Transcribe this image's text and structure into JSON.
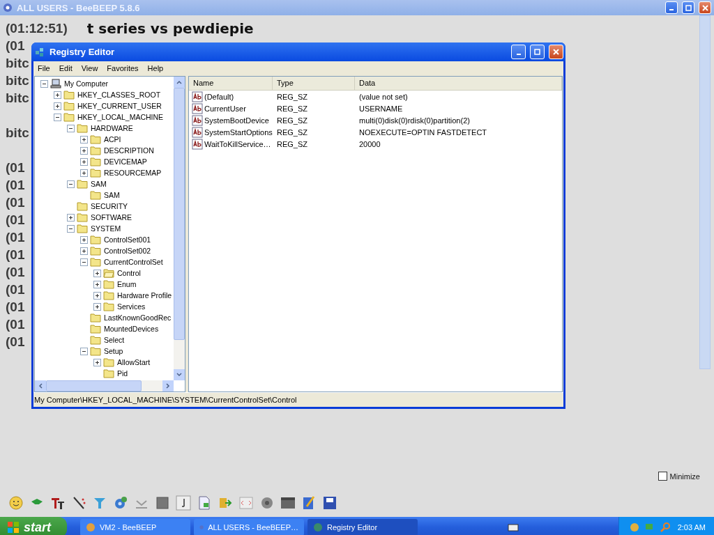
{
  "background_window": {
    "title": "ALL USERS - BeeBEEP 5.8.6",
    "chat_lines": [
      {
        "kind": "line",
        "time": "(01:12:51)",
        "message": "t series vs pewdiepie"
      },
      {
        "kind": "line",
        "time": "(01"
      },
      {
        "kind": "line",
        "time": "bitc"
      },
      {
        "kind": "line",
        "time": "bitc"
      },
      {
        "kind": "line",
        "time": "bitc"
      },
      {
        "kind": "blank"
      },
      {
        "kind": "line",
        "time": "bitc"
      },
      {
        "kind": "blank"
      },
      {
        "kind": "line",
        "time": "(01"
      },
      {
        "kind": "line",
        "time": "(01"
      },
      {
        "kind": "line",
        "time": "(01"
      },
      {
        "kind": "line",
        "time": "(01"
      },
      {
        "kind": "line",
        "time": "(01"
      },
      {
        "kind": "line",
        "time": "(01"
      },
      {
        "kind": "line",
        "time": "(01"
      },
      {
        "kind": "line",
        "time": "(01"
      },
      {
        "kind": "line",
        "time": "(01"
      },
      {
        "kind": "line",
        "time": "(01"
      },
      {
        "kind": "line",
        "time": "(01"
      }
    ],
    "minimize": {
      "label": "Minimize",
      "checked": false
    }
  },
  "registry_editor": {
    "title": "Registry Editor",
    "menu": [
      "File",
      "Edit",
      "View",
      "Favorites",
      "Help"
    ],
    "tree": [
      {
        "label": "My Computer",
        "kind": "computer",
        "expanded": true,
        "selected": false,
        "children": [
          {
            "label": "HKEY_CLASSES_ROOT",
            "expanded": false,
            "selected": false
          },
          {
            "label": "HKEY_CURRENT_USER",
            "expanded": false,
            "selected": false
          },
          {
            "label": "HKEY_LOCAL_MACHINE",
            "expanded": true,
            "selected": false,
            "children": [
              {
                "label": "HARDWARE",
                "expanded": true,
                "selected": false,
                "children": [
                  {
                    "label": "ACPI",
                    "expanded": false,
                    "selected": false
                  },
                  {
                    "label": "DESCRIPTION",
                    "expanded": false,
                    "selected": false
                  },
                  {
                    "label": "DEVICEMAP",
                    "expanded": false,
                    "selected": false
                  },
                  {
                    "label": "RESOURCEMAP",
                    "expanded": false,
                    "selected": false
                  }
                ]
              },
              {
                "label": "SAM",
                "expanded": true,
                "selected": false,
                "children": [
                  {
                    "label": "SAM",
                    "selected": false
                  }
                ]
              },
              {
                "label": "SECURITY",
                "selected": false
              },
              {
                "label": "SOFTWARE",
                "expanded": false,
                "selected": false
              },
              {
                "label": "SYSTEM",
                "expanded": true,
                "selected": false,
                "children": [
                  {
                    "label": "ControlSet001",
                    "expanded": false,
                    "selected": false
                  },
                  {
                    "label": "ControlSet002",
                    "expanded": false,
                    "selected": false
                  },
                  {
                    "label": "CurrentControlSet",
                    "expanded": true,
                    "selected": false,
                    "children": [
                      {
                        "label": "Control",
                        "expanded": false,
                        "selected": true
                      },
                      {
                        "label": "Enum",
                        "expanded": false,
                        "selected": false
                      },
                      {
                        "label": "Hardware Profile",
                        "expanded": false,
                        "selected": false
                      },
                      {
                        "label": "Services",
                        "expanded": false,
                        "selected": false
                      }
                    ]
                  },
                  {
                    "label": "LastKnownGoodRec",
                    "selected": false
                  },
                  {
                    "label": "MountedDevices",
                    "selected": false
                  },
                  {
                    "label": "Select",
                    "selected": false
                  },
                  {
                    "label": "Setup",
                    "expanded": true,
                    "selected": false,
                    "children": [
                      {
                        "label": "AllowStart",
                        "expanded": false,
                        "selected": false
                      },
                      {
                        "label": "Pid",
                        "selected": false
                      }
                    ]
                  }
                ]
              }
            ]
          }
        ]
      }
    ],
    "columns": [
      "Name",
      "Type",
      "Data"
    ],
    "values": [
      {
        "name": "(Default)",
        "type": "REG_SZ",
        "data": "(value not set)"
      },
      {
        "name": "CurrentUser",
        "type": "REG_SZ",
        "data": "USERNAME"
      },
      {
        "name": "SystemBootDevice",
        "type": "REG_SZ",
        "data": "multi(0)disk(0)rdisk(0)partition(2)"
      },
      {
        "name": "SystemStartOptions",
        "type": "REG_SZ",
        "data": "NOEXECUTE=OPTIN  FASTDETECT"
      },
      {
        "name": "WaitToKillService…",
        "type": "REG_SZ",
        "data": "20000"
      }
    ],
    "status_bar": "My Computer\\HKEY_LOCAL_MACHINE\\SYSTEM\\CurrentControlSet\\Control"
  },
  "taskbar": {
    "start": "start",
    "tasks": [
      {
        "label": "VM2 - BeeBEEP",
        "selected": false
      },
      {
        "label": "ALL USERS - BeeBEEP…",
        "selected": false
      },
      {
        "label": "Registry Editor",
        "selected": true
      }
    ],
    "clock": "2:03 AM"
  }
}
